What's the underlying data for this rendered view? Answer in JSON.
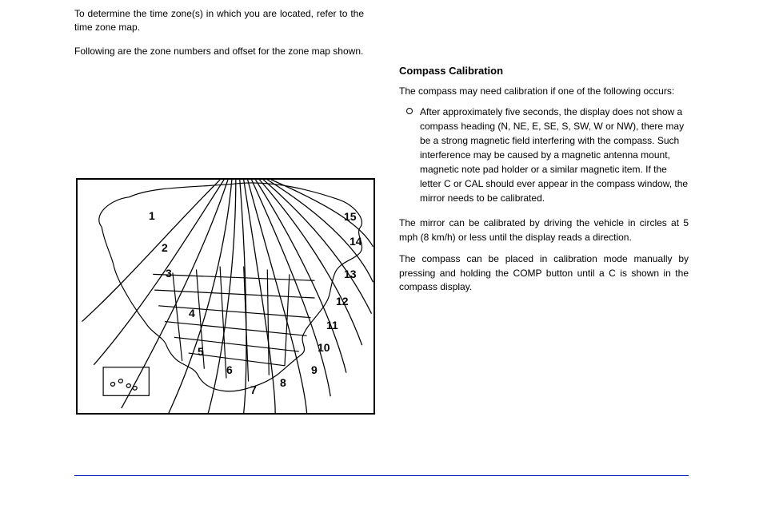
{
  "left": {
    "para1": "To determine the time zone(s) in which you are located, refer to the time zone map.",
    "para2": "Following are the zone numbers and offset for the zone map shown."
  },
  "right": {
    "heading": "Compass Calibration",
    "para1": "The compass may need calibration if one of the following occurs:",
    "li1": "After approximately five seconds, the display does not show a compass heading (N, NE, E, SE, S, SW, W or NW), there may be a strong magnetic field interfering with the compass. Such interference may be caused by a magnetic antenna mount, magnetic note pad holder or a similar magnetic item. If the letter C or CAL should ever appear in the compass window, the mirror needs to be calibrated.",
    "para2": "The mirror can be calibrated by driving the vehicle in circles at 5 mph (8 km/h) or less until the display reads a direction.",
    "para3": "The compass can be placed in calibration mode manually by pressing and holding the COMP button until a C is shown in the compass display."
  },
  "regions": {
    "n1": "1",
    "n2": "2",
    "n3": "3",
    "n4": "4",
    "n5": "5",
    "n6": "6",
    "n7": "7",
    "n8": "8",
    "n9": "9",
    "n10": "10",
    "n11": "11",
    "n12": "12",
    "n13": "13",
    "n14": "14",
    "n15": "15"
  }
}
